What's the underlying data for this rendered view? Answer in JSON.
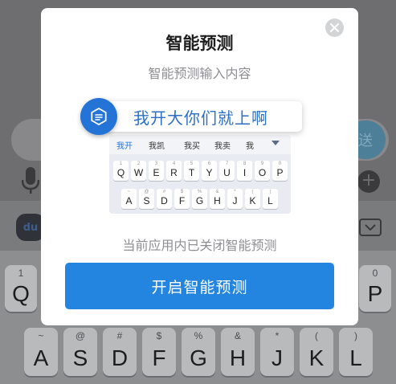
{
  "background": {
    "send_label": "送",
    "logo_label": "du",
    "keyboard_row1": [
      {
        "main": "Q",
        "sub": "1"
      },
      {
        "main": "P",
        "sub": "0"
      }
    ],
    "keyboard_row2": [
      {
        "main": "A",
        "sub": "~"
      },
      {
        "main": "S",
        "sub": "@"
      },
      {
        "main": "D",
        "sub": "#"
      },
      {
        "main": "F",
        "sub": "$"
      },
      {
        "main": "G",
        "sub": "%"
      },
      {
        "main": "H",
        "sub": "&"
      },
      {
        "main": "J",
        "sub": "*"
      },
      {
        "main": "K",
        "sub": "("
      },
      {
        "main": "L",
        "sub": ")"
      }
    ]
  },
  "modal": {
    "title": "智能预测",
    "subtitle": "智能预测输入内容",
    "demo": {
      "typed_text": "我开大你们就上啊",
      "candidates": [
        "我开",
        "我凯",
        "我买",
        "我卖",
        "我"
      ],
      "row1": [
        {
          "main": "Q",
          "sub": "1"
        },
        {
          "main": "W",
          "sub": "2"
        },
        {
          "main": "E",
          "sub": "3"
        },
        {
          "main": "R",
          "sub": "4"
        },
        {
          "main": "T",
          "sub": "5"
        },
        {
          "main": "Y",
          "sub": "6"
        },
        {
          "main": "U",
          "sub": "7"
        },
        {
          "main": "I",
          "sub": "8"
        },
        {
          "main": "O",
          "sub": "9"
        },
        {
          "main": "P",
          "sub": "0"
        }
      ],
      "row2": [
        {
          "main": "A",
          "sub": "~"
        },
        {
          "main": "S",
          "sub": "@"
        },
        {
          "main": "D",
          "sub": "#"
        },
        {
          "main": "F",
          "sub": "$"
        },
        {
          "main": "G",
          "sub": "%"
        },
        {
          "main": "H",
          "sub": "&"
        },
        {
          "main": "J",
          "sub": "*"
        },
        {
          "main": "K",
          "sub": "("
        },
        {
          "main": "L",
          "sub": ")"
        }
      ]
    },
    "status_text": "当前应用内已关闭智能预测",
    "enable_button_label": "开启智能预测"
  },
  "colors": {
    "accent": "#2385df",
    "prediction_text": "#2b6fc6"
  }
}
